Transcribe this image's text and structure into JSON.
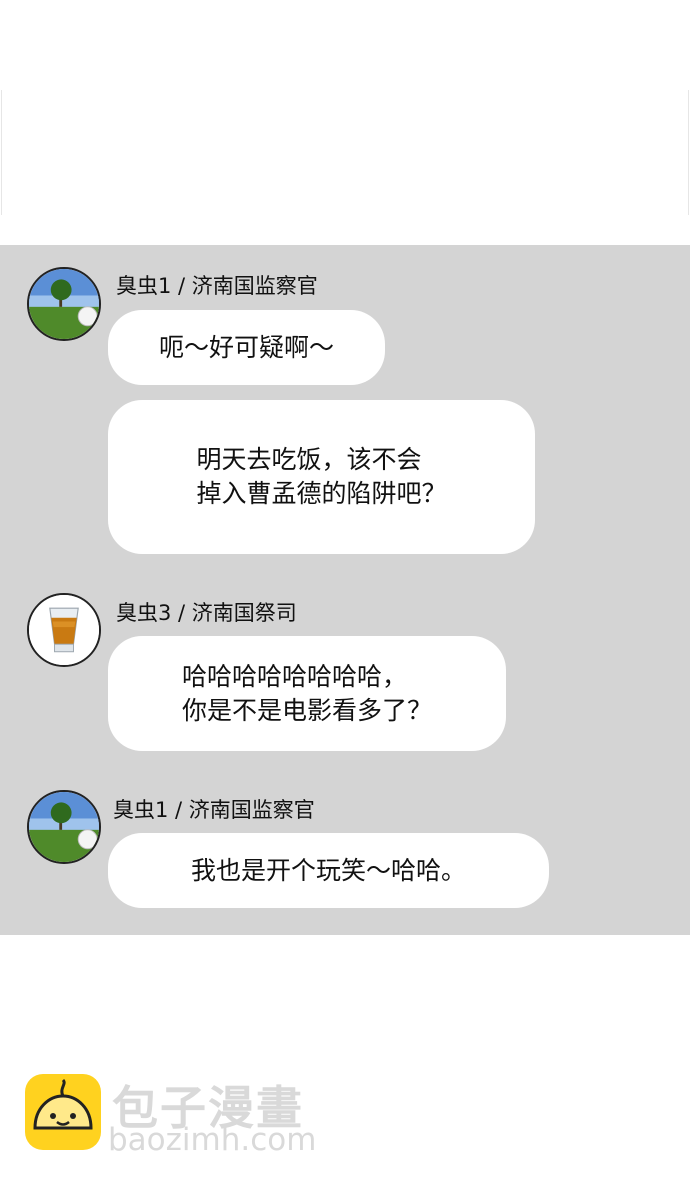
{
  "messages": [
    {
      "avatar": "golf-ball-on-grass",
      "sender": "臭虫1 / 济南国监察官",
      "bubbles": [
        {
          "lines": [
            "呃～好可疑啊～"
          ]
        },
        {
          "lines": [
            "明天去吃饭，该不会",
            "掉入曹孟德的陷阱吧？"
          ]
        }
      ]
    },
    {
      "avatar": "glass-of-liquor",
      "sender": "臭虫3 / 济南国祭司",
      "bubbles": [
        {
          "lines": [
            "哈哈哈哈哈哈哈哈，",
            "你是不是电影看多了？"
          ]
        }
      ]
    },
    {
      "avatar": "golf-ball-on-grass",
      "sender": "臭虫1 / 济南国监察官",
      "bubbles": [
        {
          "lines": [
            "我也是开个玩笑～哈哈。"
          ]
        }
      ]
    }
  ],
  "watermark": {
    "title": "包子漫畫",
    "url": "baozimh.com"
  },
  "colors": {
    "panel_bg": "#d4d4d4",
    "bubble_bg": "#ffffff",
    "logo_yellow": "#ffd21f",
    "watermark_gray": "#d9d9d9"
  }
}
